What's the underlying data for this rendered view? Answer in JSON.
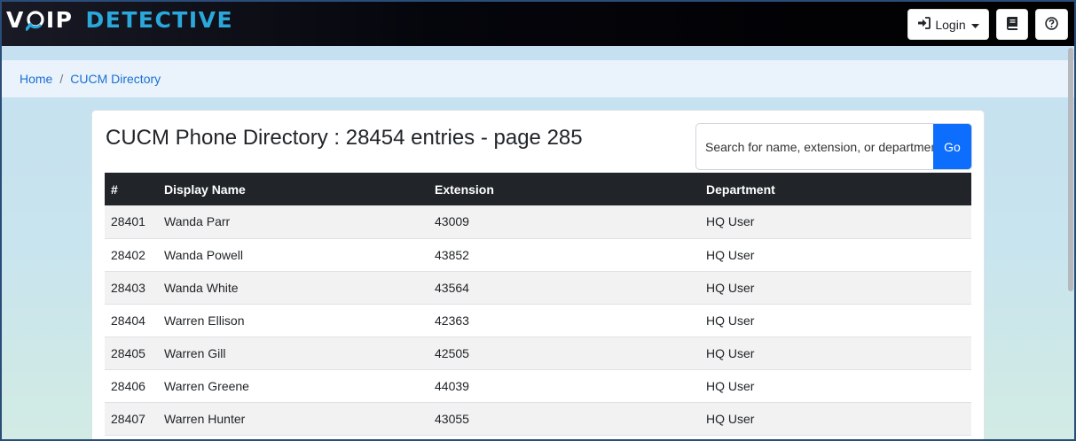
{
  "header": {
    "logo": {
      "part1": "V",
      "part2": "IP",
      "part3": "DETECTIVE"
    },
    "login_label": "Login",
    "icons": {
      "login": "sign-in-icon",
      "caret": "caret-down-icon",
      "book": "book-icon",
      "help": "question-circle-icon"
    }
  },
  "breadcrumb": {
    "home": "Home",
    "separator": "/",
    "current": "CUCM Directory"
  },
  "main": {
    "title": "CUCM Phone Directory : 28454 entries - page 285",
    "search": {
      "placeholder": "Search for name, extension, or department",
      "button": "Go"
    },
    "table": {
      "headers": [
        "#",
        "Display Name",
        "Extension",
        "Department"
      ],
      "rows": [
        [
          "28401",
          "Wanda Parr",
          "43009",
          "HQ User"
        ],
        [
          "28402",
          "Wanda Powell",
          "43852",
          "HQ User"
        ],
        [
          "28403",
          "Wanda White",
          "43564",
          "HQ User"
        ],
        [
          "28404",
          "Warren Ellison",
          "42363",
          "HQ User"
        ],
        [
          "28405",
          "Warren Gill",
          "42505",
          "HQ User"
        ],
        [
          "28406",
          "Warren Greene",
          "44039",
          "HQ User"
        ],
        [
          "28407",
          "Warren Hunter",
          "43055",
          "HQ User"
        ]
      ]
    }
  },
  "colors": {
    "accent": "#0d6efd",
    "header_bg": "#000000",
    "logo_blue": "#2aa8dc",
    "table_head": "#212529"
  }
}
